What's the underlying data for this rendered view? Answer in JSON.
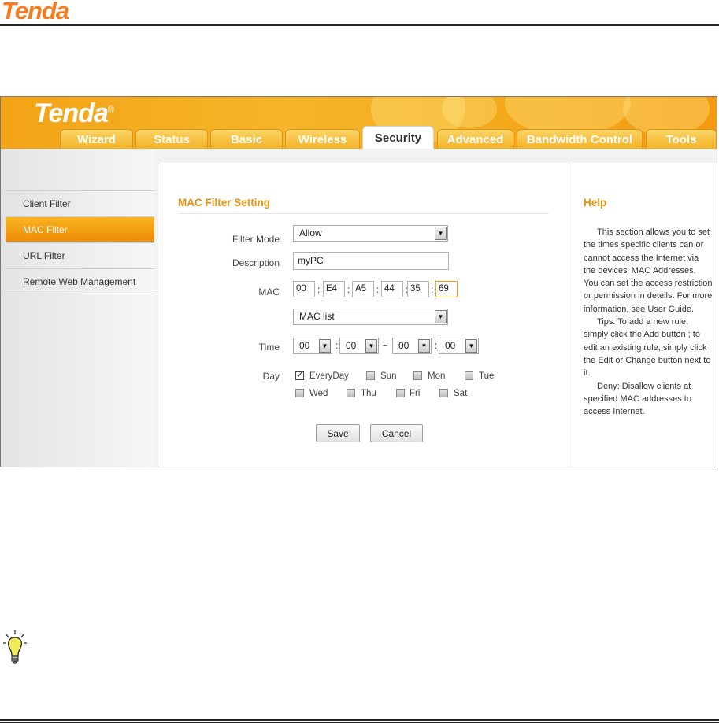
{
  "doc": {
    "logo": "Tenda"
  },
  "app": {
    "logo": "Tenda",
    "trademark": "®"
  },
  "tabs": [
    {
      "label": "Wizard",
      "active": false
    },
    {
      "label": "Status",
      "active": false
    },
    {
      "label": "Basic",
      "active": false
    },
    {
      "label": "Wireless",
      "active": false
    },
    {
      "label": "Security",
      "active": true
    },
    {
      "label": "Advanced",
      "active": false
    },
    {
      "label": "Bandwidth Control",
      "active": false
    },
    {
      "label": "Tools",
      "active": false
    }
  ],
  "sidebar": {
    "items": [
      {
        "label": "Client Filter",
        "active": false
      },
      {
        "label": "MAC Filter",
        "active": true
      },
      {
        "label": "URL Filter",
        "active": false
      },
      {
        "label": "Remote Web Management",
        "active": false
      }
    ]
  },
  "form": {
    "title": "MAC Filter Setting",
    "filter_mode_label": "Filter Mode",
    "filter_mode_value": "Allow",
    "description_label": "Description",
    "description_value": "myPC",
    "mac_label": "MAC",
    "mac": [
      "00",
      "E4",
      "A5",
      "44",
      "35",
      "69"
    ],
    "mac_separator": ":",
    "mac_list_value": "MAC list",
    "time_label": "Time",
    "time": [
      "00",
      "00",
      "00",
      "00"
    ],
    "time_separator": ":",
    "time_range_separator": "~",
    "day_label": "Day",
    "days": [
      {
        "label": "EveryDay",
        "checked": true
      },
      {
        "label": "Sun",
        "checked": false
      },
      {
        "label": "Mon",
        "checked": false
      },
      {
        "label": "Tue",
        "checked": false
      },
      {
        "label": "Wed",
        "checked": false
      },
      {
        "label": "Thu",
        "checked": false
      },
      {
        "label": "Fri",
        "checked": false
      },
      {
        "label": "Sat",
        "checked": false
      }
    ],
    "save_label": "Save",
    "cancel_label": "Cancel"
  },
  "help": {
    "title": "Help",
    "paragraphs": [
      "This section allows you to set the times specific clients can or cannot access the Internet via the devices' MAC Addresses. You can set the access restriction or permission in deteils. For more information, see User Guide.",
      "Tips: To add a new rule, simply click the Add button ; to edit an existing rule, simply click the Edit or Change button next to it.",
      "Deny: Disallow clients at specified MAC addresses to access Internet."
    ]
  },
  "colors": {
    "brand_orange": "#f47b20",
    "header_orange": "#f5a91c",
    "accent_title": "#e8910e"
  },
  "icons": {
    "tip": "lightbulb-icon",
    "dropdown": "dropdown-arrow-icon",
    "checkbox": "checkbox-icon"
  }
}
